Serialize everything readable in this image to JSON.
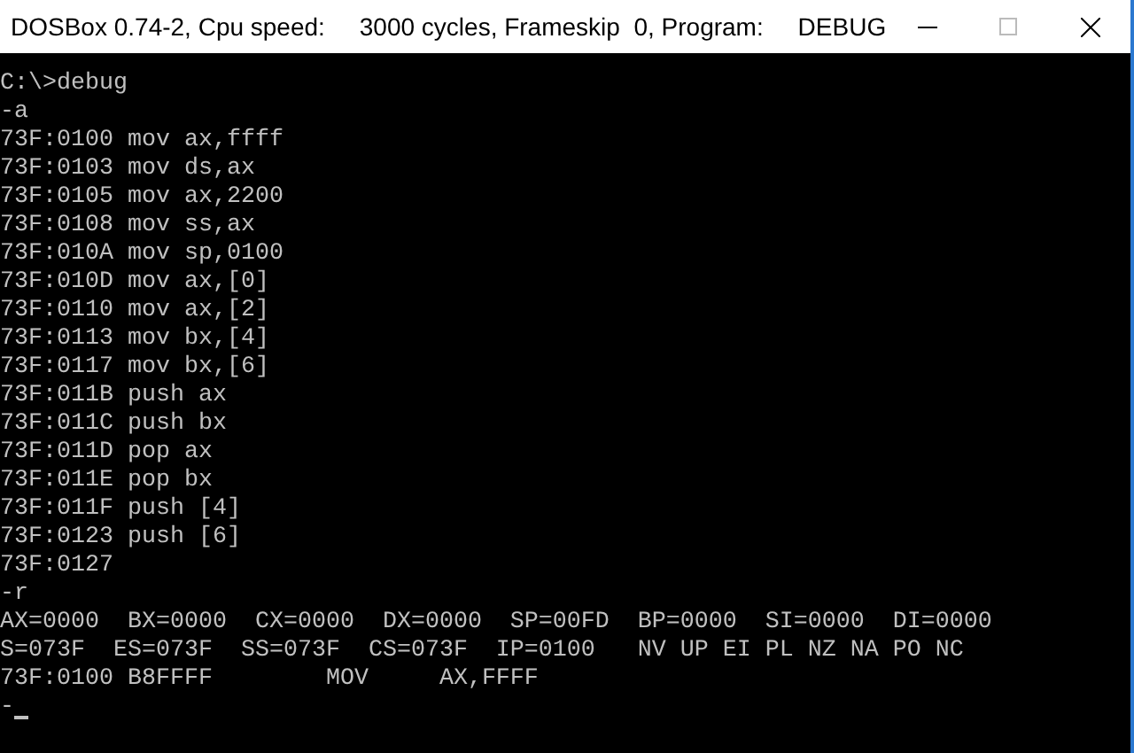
{
  "window": {
    "title": "DOSBox 0.74-2, Cpu speed:     3000 cycles, Frameskip  0, Program:     DEBUG"
  },
  "terminal": {
    "lines": [
      "C:\\>debug",
      "-a",
      "73F:0100 mov ax,ffff",
      "73F:0103 mov ds,ax",
      "73F:0105 mov ax,2200",
      "73F:0108 mov ss,ax",
      "73F:010A mov sp,0100",
      "73F:010D mov ax,[0]",
      "73F:0110 mov ax,[2]",
      "73F:0113 mov bx,[4]",
      "73F:0117 mov bx,[6]",
      "73F:011B push ax",
      "73F:011C push bx",
      "73F:011D pop ax",
      "73F:011E pop bx",
      "73F:011F push [4]",
      "73F:0123 push [6]",
      "73F:0127",
      "-r",
      "AX=0000  BX=0000  CX=0000  DX=0000  SP=00FD  BP=0000  SI=0000  DI=0000",
      "S=073F  ES=073F  SS=073F  CS=073F  IP=0100   NV UP EI PL NZ NA PO NC",
      "73F:0100 B8FFFF        MOV     AX,FFFF",
      "-"
    ]
  }
}
